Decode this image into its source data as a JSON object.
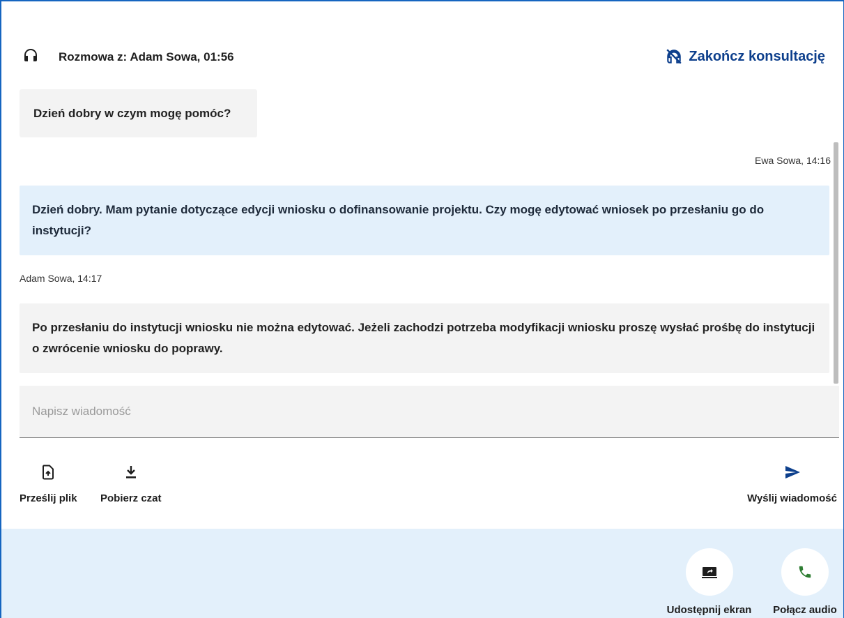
{
  "header": {
    "title": "Rozmowa z: Adam Sowa, 01:56",
    "end_label": "Zakończ konsultację"
  },
  "messages": {
    "greeting": "Dzień dobry w czym mogę pomóc?",
    "user_sender": "Ewa Sowa, 14:16",
    "user_text": "Dzień dobry. Mam pytanie dotyczące edycji wniosku o dofinansowanie projektu. Czy mogę edytować wniosek po przesłaniu go do instytucji?",
    "agent_sender": "Adam Sowa, 14:17",
    "agent_text": "Po przesłaniu do instytucji wniosku nie można edytować. Jeżeli zachodzi potrzeba modyfikacji wniosku proszę wysłać prośbę do instytucji o zwrócenie wniosku do poprawy."
  },
  "composer": {
    "placeholder": "Napisz wiadomość",
    "value": ""
  },
  "toolbar": {
    "upload_label": "Prześlij plik",
    "download_label": "Pobierz czat",
    "send_label": "Wyślij wiadomość"
  },
  "footer": {
    "share_label": "Udostępnij ekran",
    "audio_label": "Połącz audio"
  },
  "icons": {
    "header": "headphones-icon",
    "end": "headphones-off-icon",
    "upload": "file-upload-icon",
    "download": "download-icon",
    "send": "send-icon",
    "share": "screen-share-icon",
    "audio": "phone-icon"
  },
  "colors": {
    "accent": "#0d3f8c",
    "frame": "#1565c0",
    "user_bubble": "#e3f0fb",
    "agent_bubble": "#f3f3f3",
    "footer_bg": "#e3f0fb",
    "phone_green": "#2e7d32"
  }
}
